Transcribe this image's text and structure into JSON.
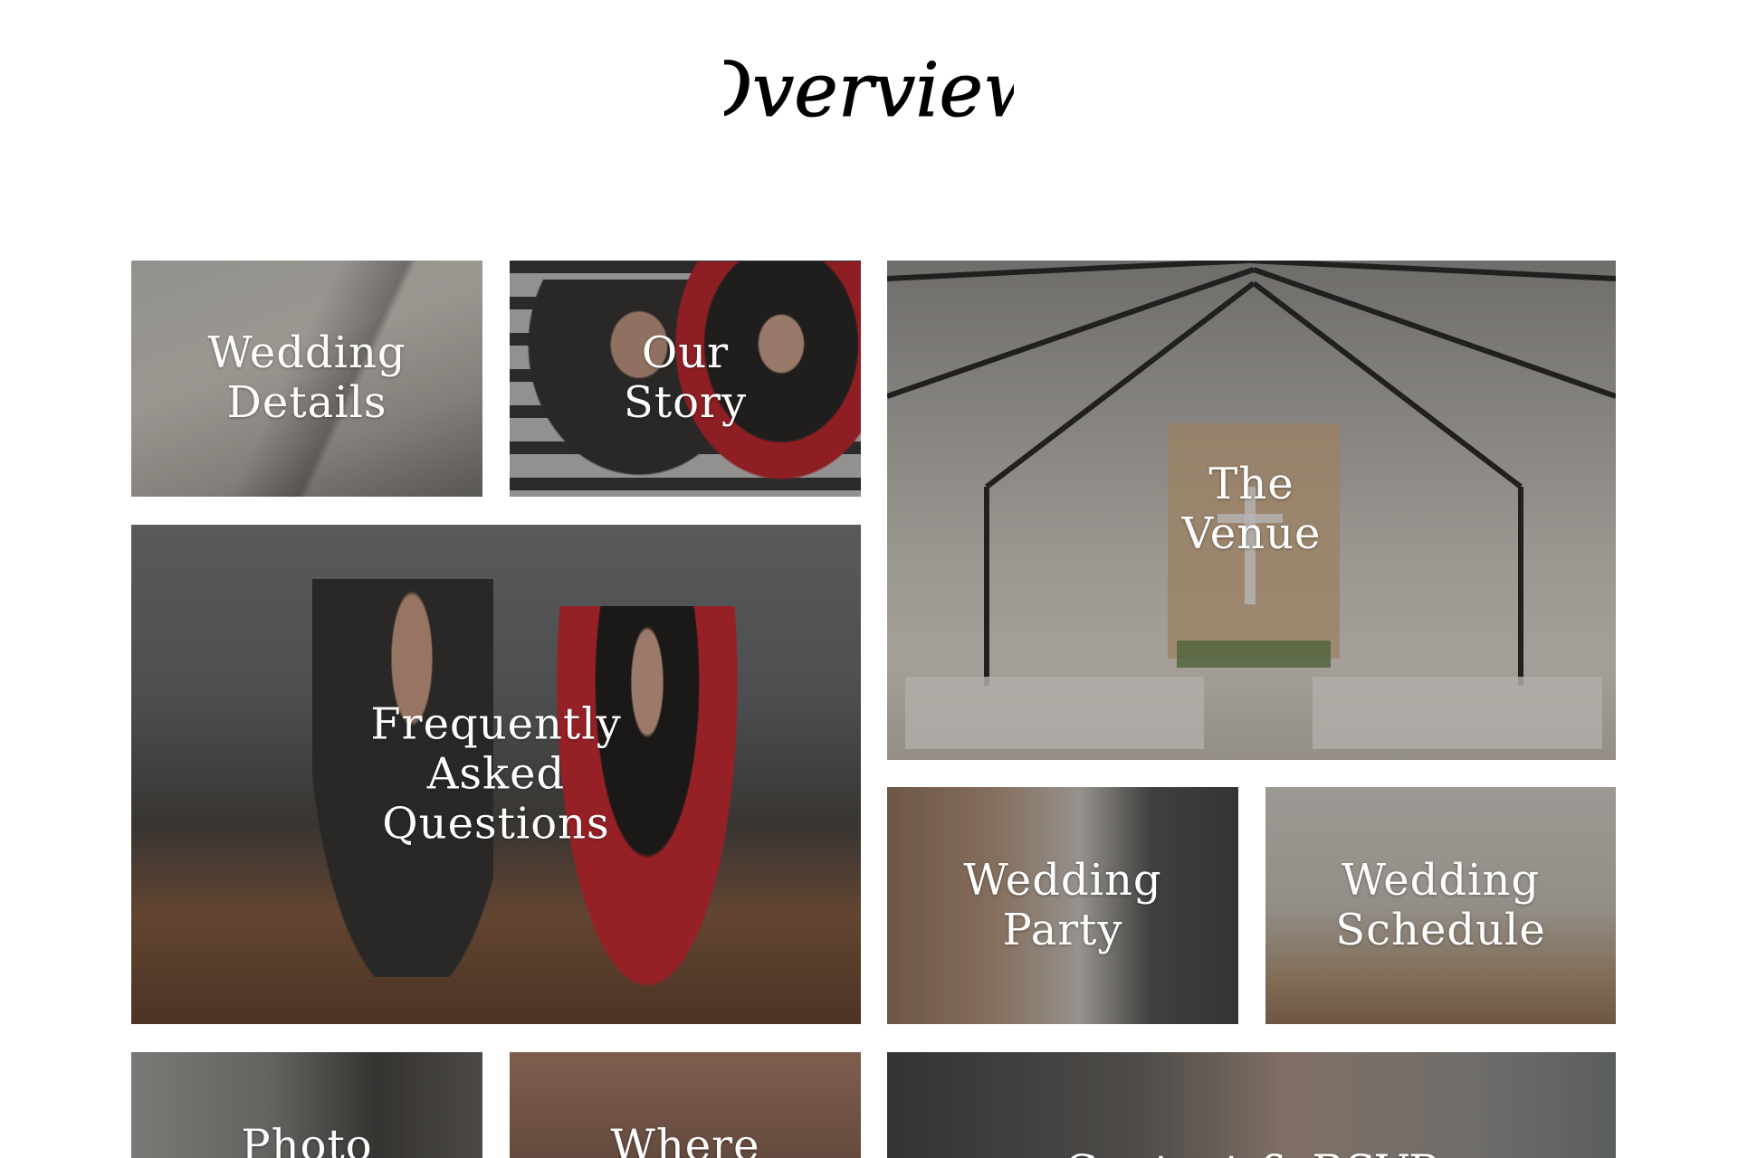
{
  "heading": {
    "title": "Overview"
  },
  "tiles": [
    {
      "id": "wedding-details",
      "label_lines": [
        "Wedding",
        "Details"
      ]
    },
    {
      "id": "our-story",
      "label_lines": [
        "Our",
        "Story"
      ]
    },
    {
      "id": "the-venue",
      "label_lines": [
        "The",
        "Venue"
      ]
    },
    {
      "id": "faq",
      "label_lines": [
        "Frequently",
        "Asked",
        "Questions"
      ]
    },
    {
      "id": "wedding-party",
      "label_lines": [
        "Wedding",
        "Party"
      ]
    },
    {
      "id": "wedding-schedule",
      "label_lines": [
        "Wedding",
        "Schedule"
      ]
    },
    {
      "id": "photo",
      "label_lines": [
        "Photo"
      ]
    },
    {
      "id": "where",
      "label_lines": [
        "Where"
      ]
    },
    {
      "id": "contact-rsvp",
      "label_lines": [
        "Contact & RSVP"
      ]
    }
  ],
  "colors": {
    "background": "#ffffff",
    "heading": "#000000",
    "tile_text": "#ffffff"
  }
}
